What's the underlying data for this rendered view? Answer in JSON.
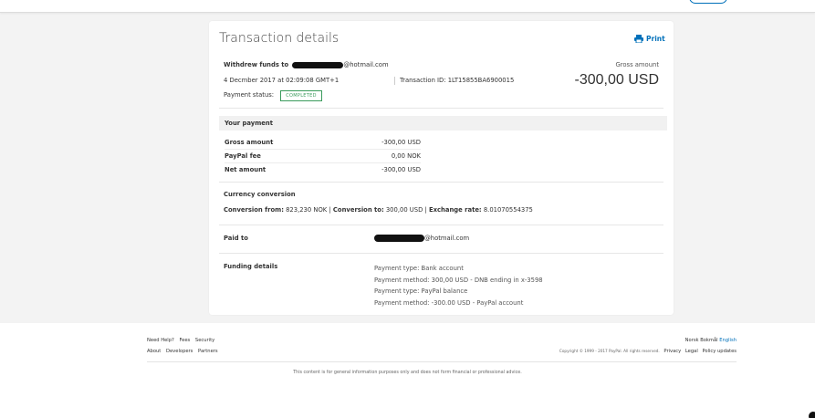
{
  "card": {
    "title": "Transaction details",
    "print_label": "Print",
    "withdraw_prefix": "Withdrew funds to",
    "withdraw_email_suffix": "@hotmail.com",
    "date": "4 Decmber 2017 at 02:09:08 GMT+1",
    "transaction_id": "Transaction ID: 1LT15855BA6900015",
    "payment_status_label": "Payment status:",
    "payment_status": "COMPLETED",
    "gross_label": "Gross amount",
    "gross_value": "-300,00 USD"
  },
  "your_payment": {
    "title": "Your payment",
    "rows": [
      {
        "label": "Gross amount",
        "value": "-300,00 USD"
      },
      {
        "label": "PayPal fee",
        "value": "0,00 NOK"
      },
      {
        "label": "Net amount",
        "value": "-300,00 USD"
      }
    ]
  },
  "currency": {
    "title": "Currency conversion",
    "from_label": "Conversion from:",
    "from_value": "823,230 NOK",
    "sep1": "|",
    "to_label": "Conversion to:",
    "to_value": "300,00 USD",
    "sep2": "|",
    "rate_label": "Exchange rate:",
    "rate_value": "8.01070554375"
  },
  "paid_to": {
    "label": "Paid to",
    "email_suffix": "@hotmail.com"
  },
  "funding": {
    "label": "Funding details",
    "lines": [
      "Payment type: Bank account",
      "Payment method: 300,00 USD - DNB ending in x-3598",
      "Payment type: PayPal balance",
      "Payment method: -300.00 USD - PayPal account"
    ]
  },
  "footer": {
    "links_row1": [
      "Need Help?",
      "Fees",
      "Security"
    ],
    "links_row2": [
      "About",
      "Developers",
      "Partners"
    ],
    "lang_current": "Norsk Bokmål",
    "lang_alt": "English",
    "copyright": "Copyright © 1999 - 2017 PayPal. All rights reserved.",
    "legal_links": [
      "Privacy",
      "Legal",
      "Policy updates"
    ],
    "disclaimer": "This content is for general information purposes only and does not form financial or professional advice."
  },
  "colors": {
    "accent": "#0070ba",
    "status_green": "#3a9b5c"
  }
}
